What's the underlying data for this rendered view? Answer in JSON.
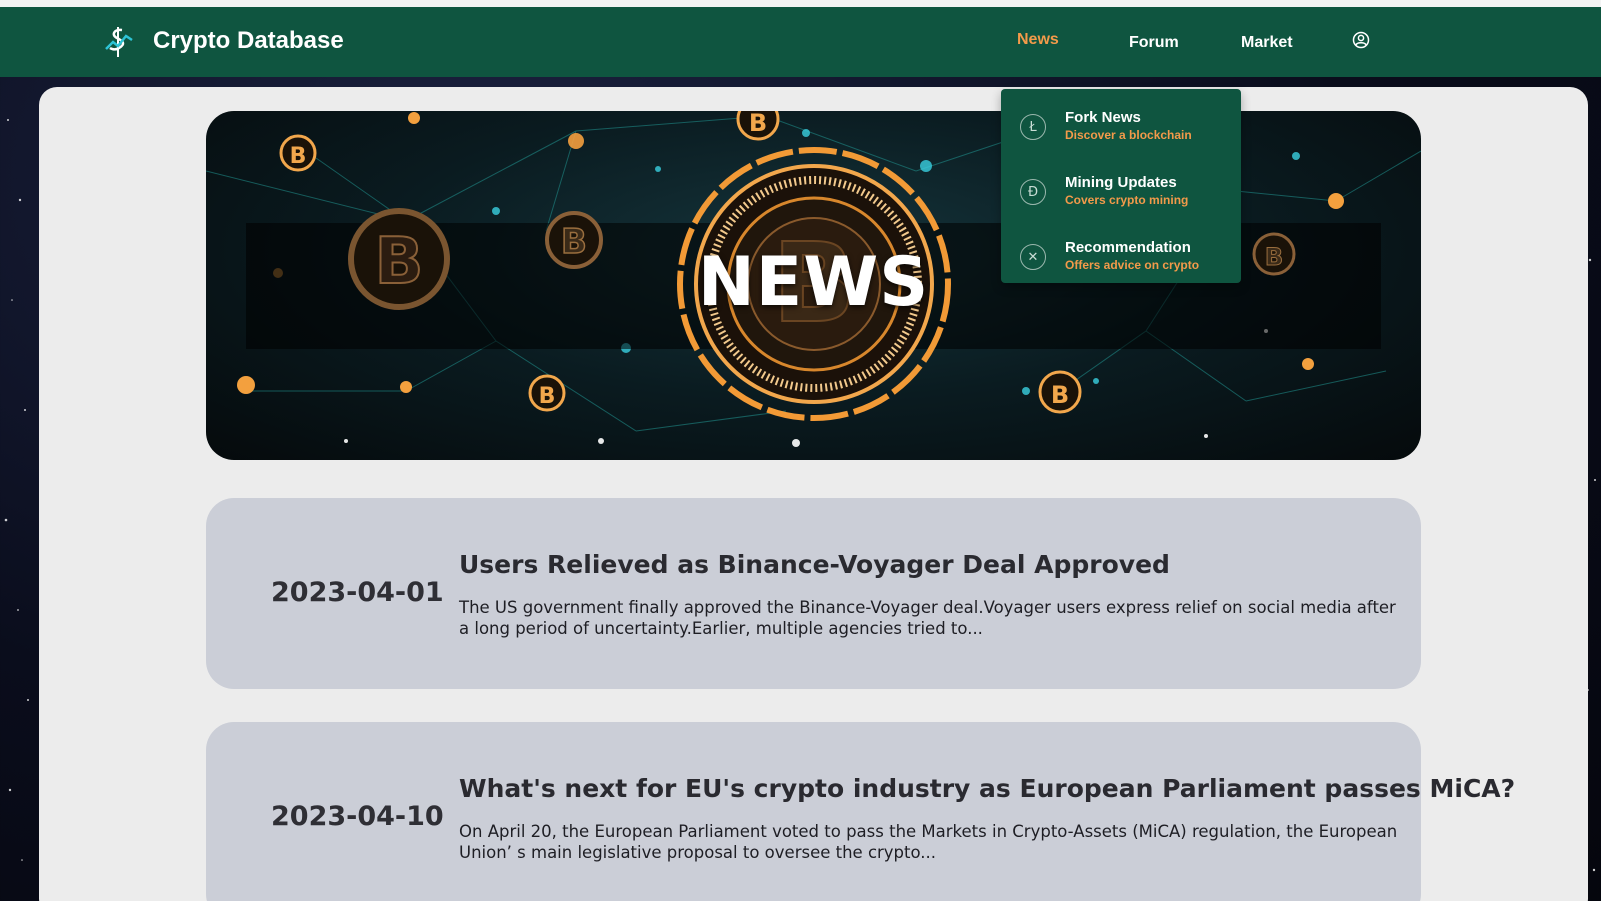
{
  "app": {
    "brand": "Crypto Database"
  },
  "nav": {
    "news": "News",
    "forum": "Forum",
    "market": "Market"
  },
  "dropdown": [
    {
      "title": "Fork News",
      "subtitle": "Discover a blockchain",
      "icon": "litecoin-icon"
    },
    {
      "title": "Mining Updates",
      "subtitle": "Covers crypto mining",
      "icon": "dash-icon"
    },
    {
      "title": "Recommendation",
      "subtitle": "Offers advice on crypto",
      "icon": "ripple-icon"
    }
  ],
  "banner": {
    "title": "NEWS"
  },
  "news": [
    {
      "date": "2023-04-01",
      "title": "Users Relieved as Binance-Voyager Deal Approved",
      "excerpt": "The US government finally approved the Binance-Voyager deal.Voyager users express relief on social media after a long period of uncertainty.Earlier, multiple agencies tried to..."
    },
    {
      "date": "2023-04-10",
      "title": "What's next for EU's crypto industry as European Parliament passes MiCA?",
      "excerpt": "On April 20, the European Parliament voted to pass the Markets in Crypto-Assets (MiCA) regulation, the European Union’ s main legislative proposal to oversee the crypto..."
    }
  ],
  "colors": {
    "header": "#0f5540",
    "accent": "#f39a4a",
    "card": "#cbced7",
    "panel": "#ececec"
  }
}
